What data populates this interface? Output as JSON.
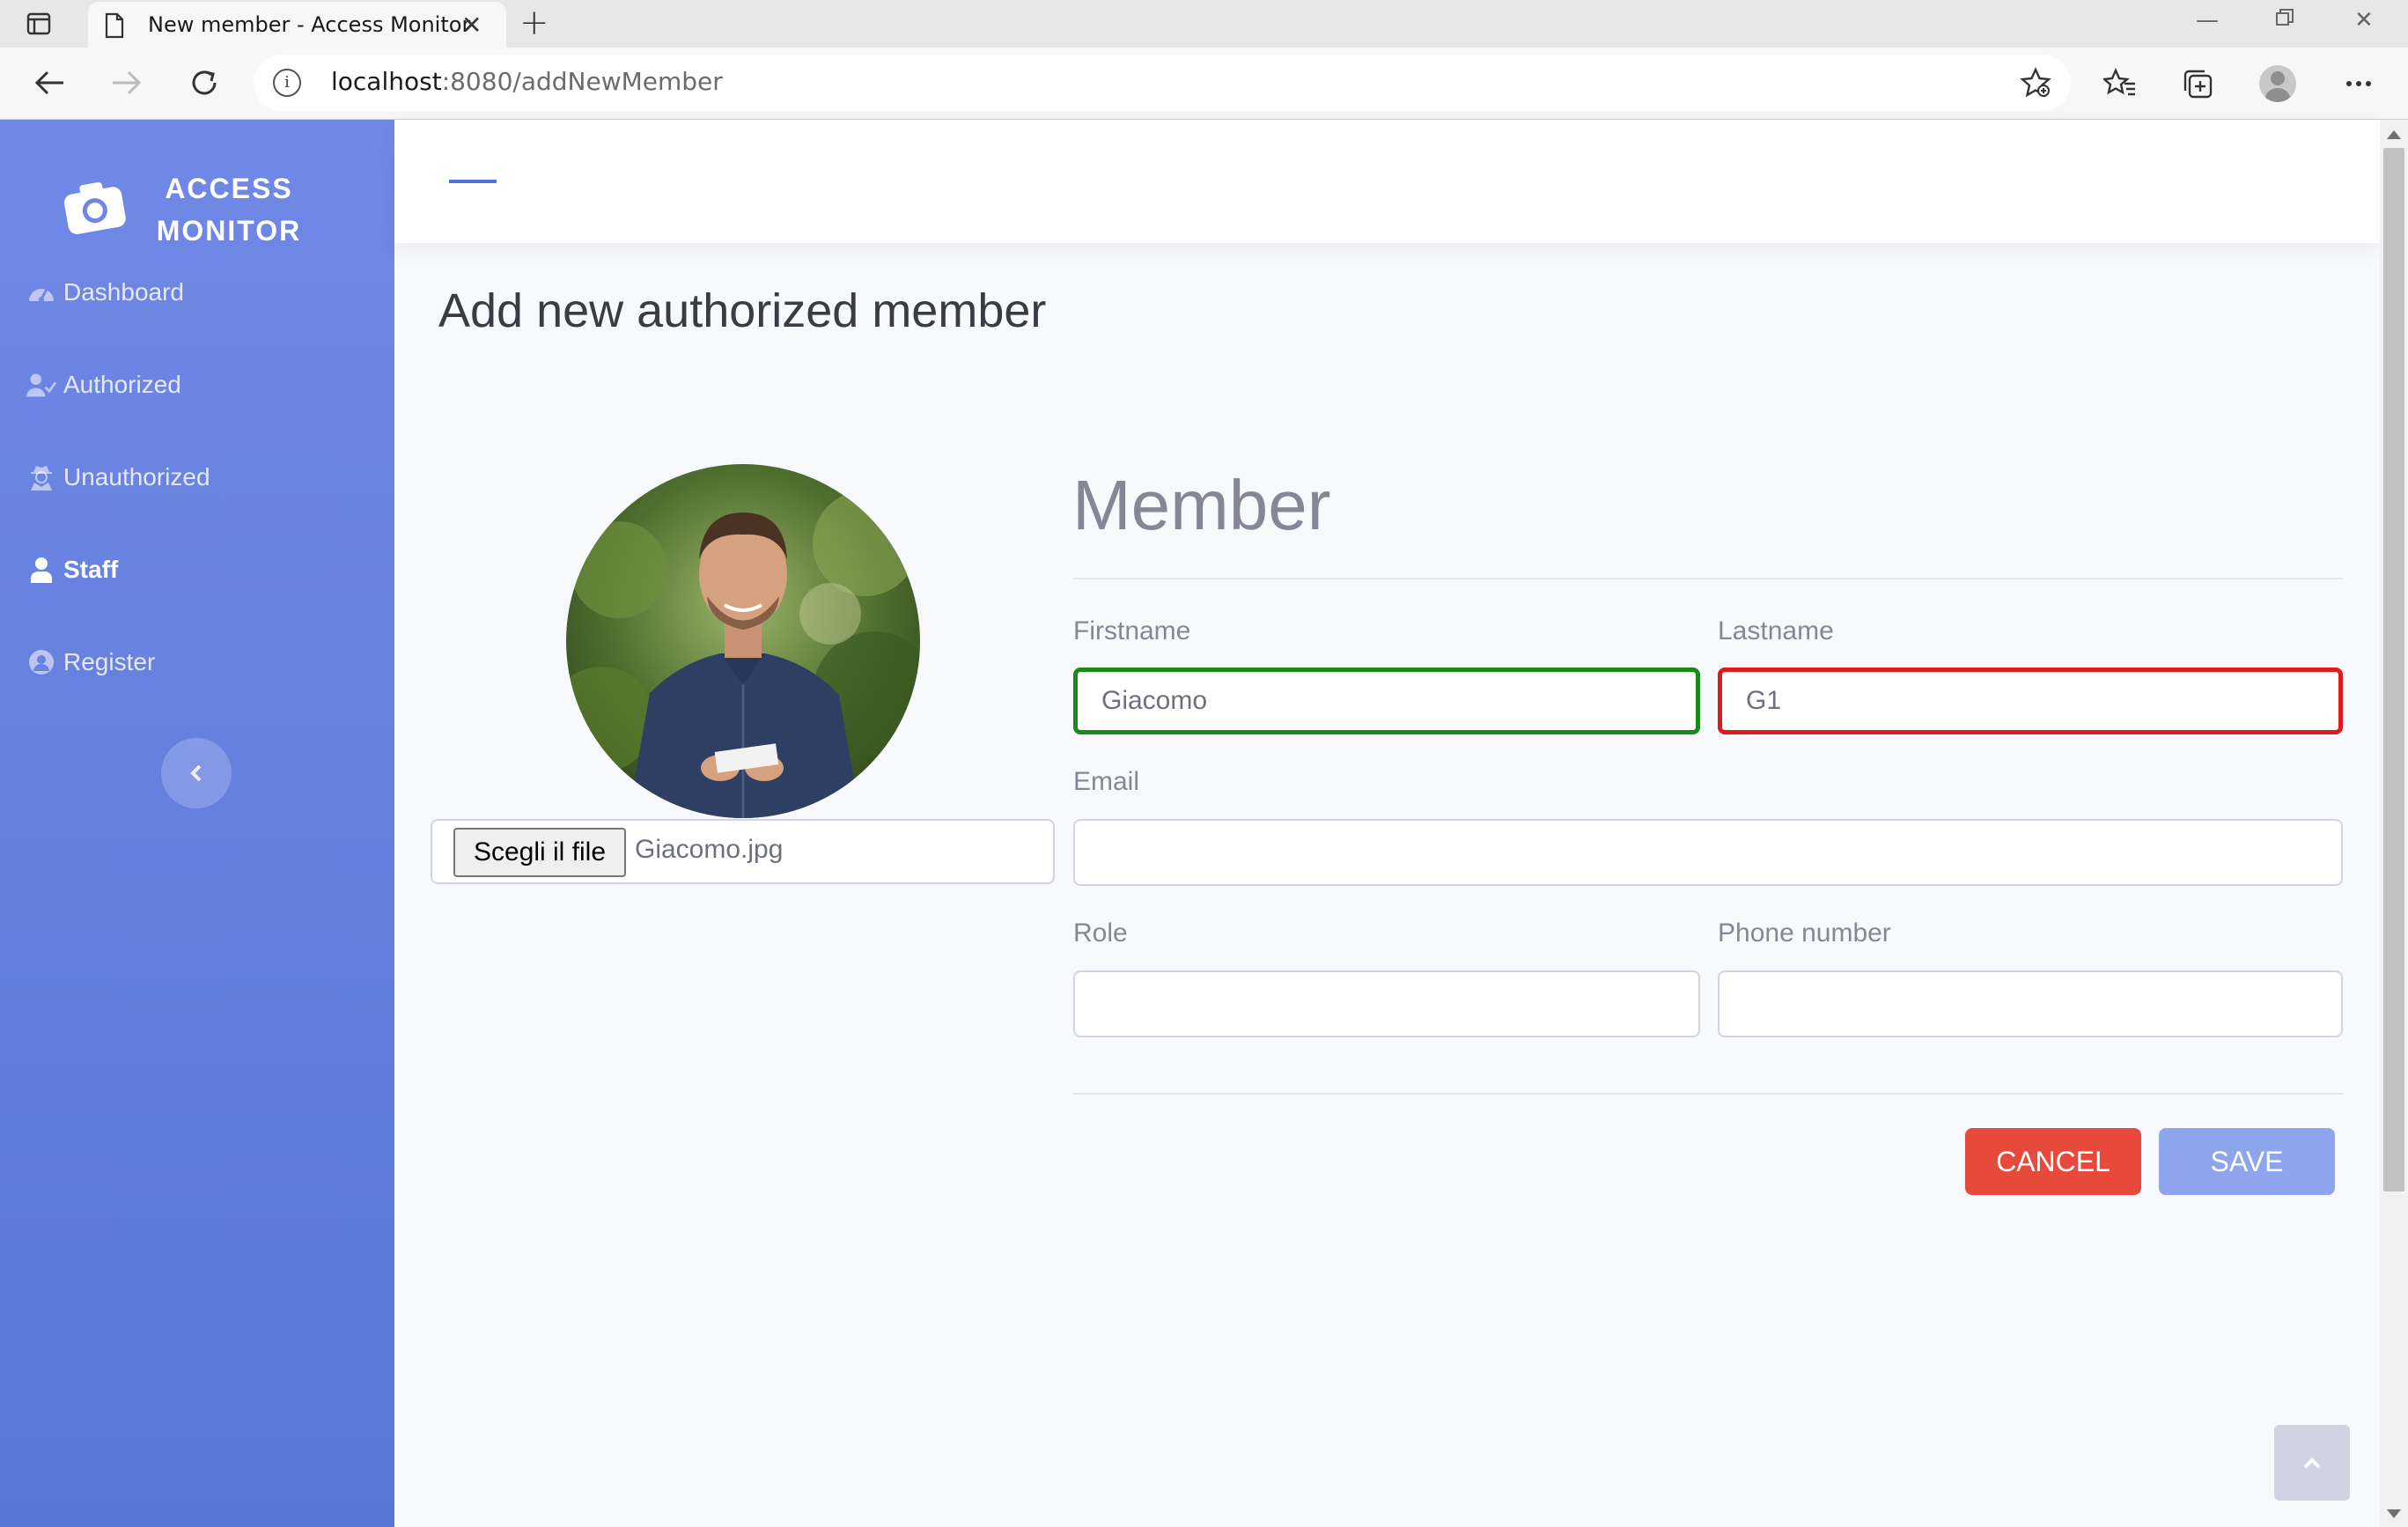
{
  "browser": {
    "tab_title": "New member - Access Monitor",
    "url_host": "localhost",
    "url_rest": ":8080/addNewMember"
  },
  "sidebar": {
    "brand_line1": "ACCESS",
    "brand_line2": "MONITOR",
    "items": [
      {
        "label": "Dashboard",
        "icon": "tachometer-icon"
      },
      {
        "label": "Authorized",
        "icon": "user-check-icon"
      },
      {
        "label": "Unauthorized",
        "icon": "user-secret-icon"
      },
      {
        "label": "Staff",
        "icon": "user-icon",
        "active": true
      },
      {
        "label": "Register",
        "icon": "user-circle-icon"
      }
    ]
  },
  "page": {
    "title": "Add new authorized member"
  },
  "photo": {
    "file_button": "Scegli il file",
    "file_name": "Giacomo.jpg"
  },
  "form": {
    "section_title": "Member",
    "firstname_label": "Firstname",
    "firstname_value": "Giacomo",
    "lastname_label": "Lastname",
    "lastname_value": "G1",
    "email_label": "Email",
    "email_value": "",
    "role_label": "Role",
    "role_value": "",
    "phone_label": "Phone number",
    "phone_value": "",
    "cancel_label": "CANCEL",
    "save_label": "SAVE"
  },
  "colors": {
    "sidebar_top": "#7088e6",
    "sidebar_bottom": "#5a77d8",
    "valid_border": "#1a8a1a",
    "invalid_border": "#e01b1b",
    "cancel_button": "#e74a3b",
    "save_button": "#8ea4ec",
    "accent": "#4e73df"
  }
}
